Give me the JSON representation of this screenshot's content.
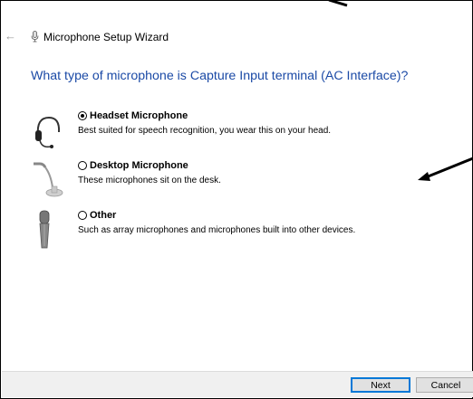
{
  "window": {
    "title": "Microphone Setup Wizard",
    "back_icon": "←",
    "close_icon": "✕"
  },
  "question": "What type of microphone is Capture Input terminal (AC Interface)?",
  "options": [
    {
      "label": "Headset Microphone",
      "description": "Best suited for speech recognition, you wear this on your head.",
      "selected": true,
      "icon": "headset-icon"
    },
    {
      "label": "Desktop Microphone",
      "description": "These microphones sit on the desk.",
      "selected": false,
      "icon": "desktop-microphone-icon"
    },
    {
      "label": "Other",
      "description": "Such as array microphones and microphones built into other devices.",
      "selected": false,
      "icon": "handheld-microphone-icon"
    }
  ],
  "buttons": {
    "next": "Next",
    "cancel": "Cancel"
  },
  "colors": {
    "question": "#1b4aa6",
    "footer": "#f0f0f0",
    "default_button_border": "#0078d7"
  }
}
